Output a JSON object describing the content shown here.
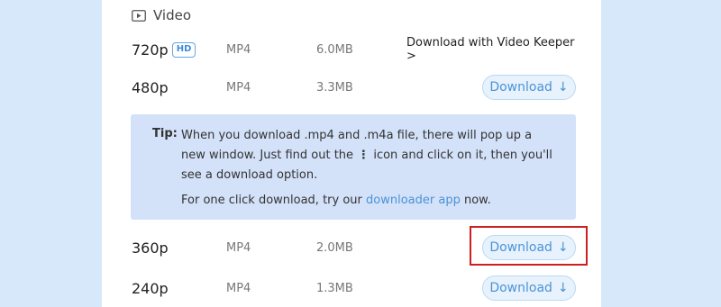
{
  "section": {
    "title": "Video",
    "icon": "video-icon"
  },
  "rows": [
    {
      "resolution": "720p",
      "badge": "HD",
      "format": "MP4",
      "size": "6.0MB",
      "action_label": "Download with Video Keeper >"
    },
    {
      "resolution": "480p",
      "format": "MP4",
      "size": "3.3MB",
      "action_label": "Download",
      "action_icon": "↓"
    },
    {
      "resolution": "360p",
      "format": "MP4",
      "size": "2.0MB",
      "action_label": "Download",
      "action_icon": "↓"
    },
    {
      "resolution": "240p",
      "format": "MP4",
      "size": "1.3MB",
      "action_label": "Download",
      "action_icon": "↓"
    }
  ],
  "tip": {
    "label": "Tip:",
    "line1_before": "When you download .mp4 and .m4a file, there will pop up a new window. Just find out the",
    "dots": "⋮",
    "line1_after": "icon and click on it, then you'll see a download option.",
    "line2_before": "For one click download, try our",
    "line2_link": "downloader app",
    "line2_after": "now."
  },
  "colors": {
    "accent": "#4b93d6",
    "highlight": "#cc1f1f",
    "tip_bg": "#d3e1f9",
    "page_bg": "#d6e8fa"
  }
}
